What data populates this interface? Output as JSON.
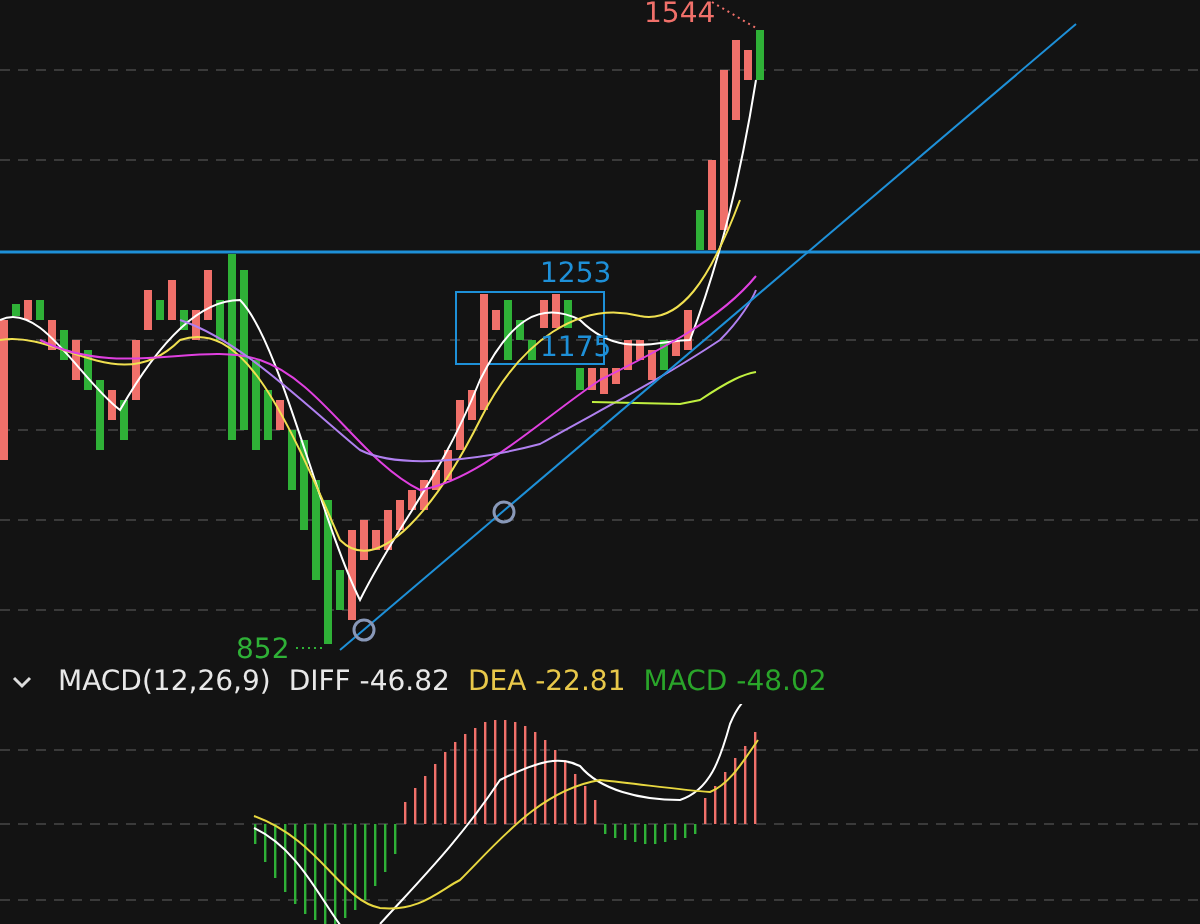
{
  "price_chart": {
    "high_label": "1544",
    "box_high_label": "1253",
    "box_low_label": "1175",
    "low_label": "852"
  },
  "indicator_bar": {
    "expanded": true,
    "name": "MACD(12,26,9)",
    "diff": "DIFF -46.82",
    "dea": "DEA -22.81",
    "macd": "MACD -48.02"
  }
}
